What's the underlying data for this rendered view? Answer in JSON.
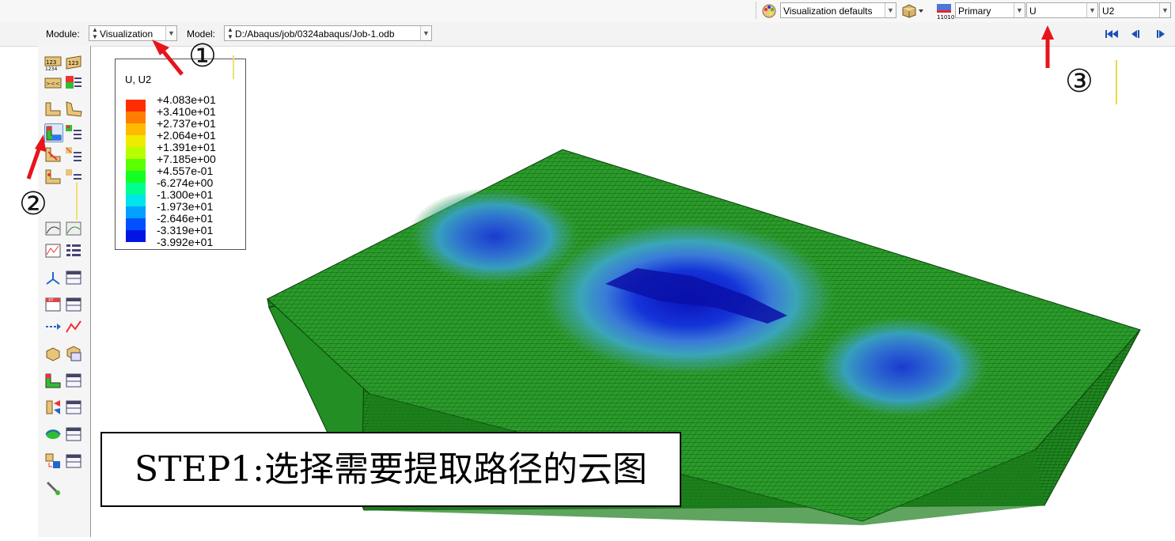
{
  "toolbar_top": {
    "color_scheme_label": "Visualization defaults",
    "variable_position": "Primary",
    "field_output": "U",
    "component": "U2"
  },
  "context_bar": {
    "module_label": "Module:",
    "module_value": "Visualization",
    "model_label": "Model:",
    "model_value": "D:/Abaqus/job/0324abaqus/Job-1.odb"
  },
  "legend": {
    "title": "U, U2",
    "entries": [
      {
        "value": "+4.083e+01",
        "color": "#ff0000"
      },
      {
        "value": "+3.410e+01",
        "color": "#ff5a00"
      },
      {
        "value": "+2.737e+01",
        "color": "#ffa000"
      },
      {
        "value": "+2.064e+01",
        "color": "#ffd500"
      },
      {
        "value": "+1.391e+01",
        "color": "#e1ff00"
      },
      {
        "value": "+7.185e+00",
        "color": "#8cff00"
      },
      {
        "value": "+4.557e-01",
        "color": "#28ff00"
      },
      {
        "value": "-6.274e+00",
        "color": "#00ff46"
      },
      {
        "value": "-1.300e+01",
        "color": "#00ffd7"
      },
      {
        "value": "-1.973e+01",
        "color": "#00c8ff"
      },
      {
        "value": "-2.646e+01",
        "color": "#0078ff"
      },
      {
        "value": "-3.319e+01",
        "color": "#0028ff"
      },
      {
        "value": "-3.992e+01",
        "color": "#0000c8"
      }
    ]
  },
  "annotations": {
    "marker_1": "①",
    "marker_2": "②",
    "marker_3": "③",
    "step_text": "STEP1:选择需要提取路径的云图"
  },
  "colors": {
    "annotation_arrow": "#e8141b",
    "mesh_green": "#2a9a2a",
    "deformation_blue": "#1e3cff"
  }
}
